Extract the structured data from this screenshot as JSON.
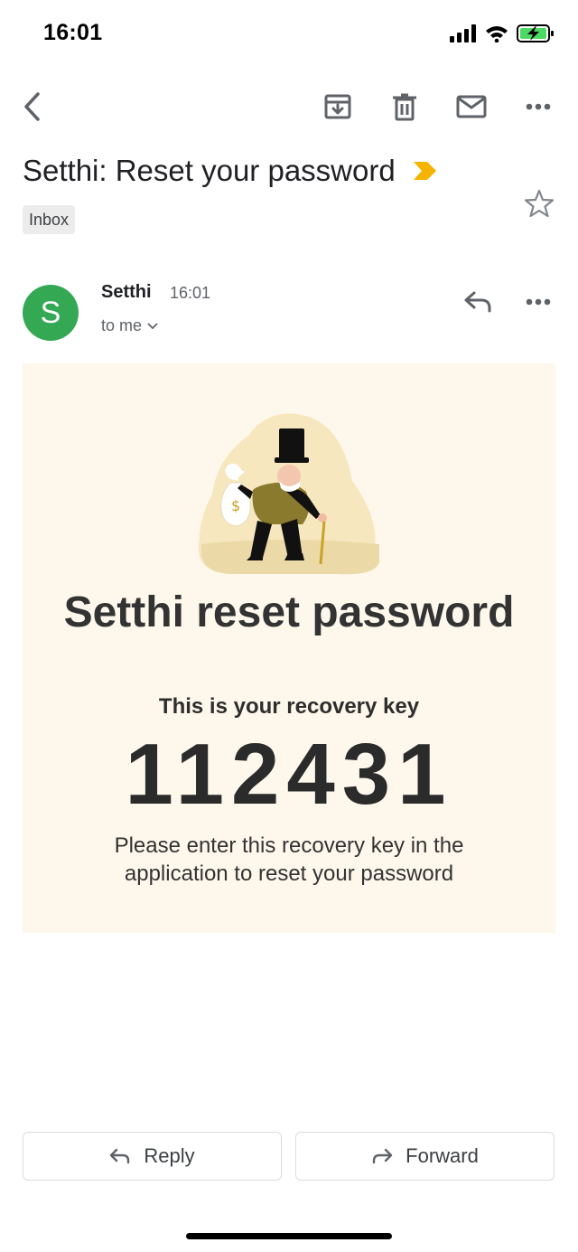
{
  "status_bar": {
    "time": "16:01",
    "icons": [
      "cellular-signal-icon",
      "wifi-icon",
      "battery-charging-icon"
    ]
  },
  "toolbar": {
    "icons": [
      "back-arrow-icon",
      "archive-icon",
      "trash-icon",
      "mark-unread-icon",
      "more-options-icon"
    ]
  },
  "email": {
    "subject": "Setthi: Reset your password",
    "importance_marker_color": "#f4b400",
    "label": "Inbox",
    "sender": {
      "initial": "S",
      "avatar_color": "#34a853",
      "name": "Setthi",
      "time": "16:01",
      "recipient": "to me"
    },
    "body": {
      "background_color": "#fef8ec",
      "illustration": "gentleman-with-money-bag",
      "title": "Setthi reset password",
      "subtitle": "This is your recovery key",
      "recovery_key": "112431",
      "message": "Please enter this recovery key in the application to reset your password"
    }
  },
  "actions": {
    "reply_label": "Reply",
    "forward_label": "Forward"
  }
}
